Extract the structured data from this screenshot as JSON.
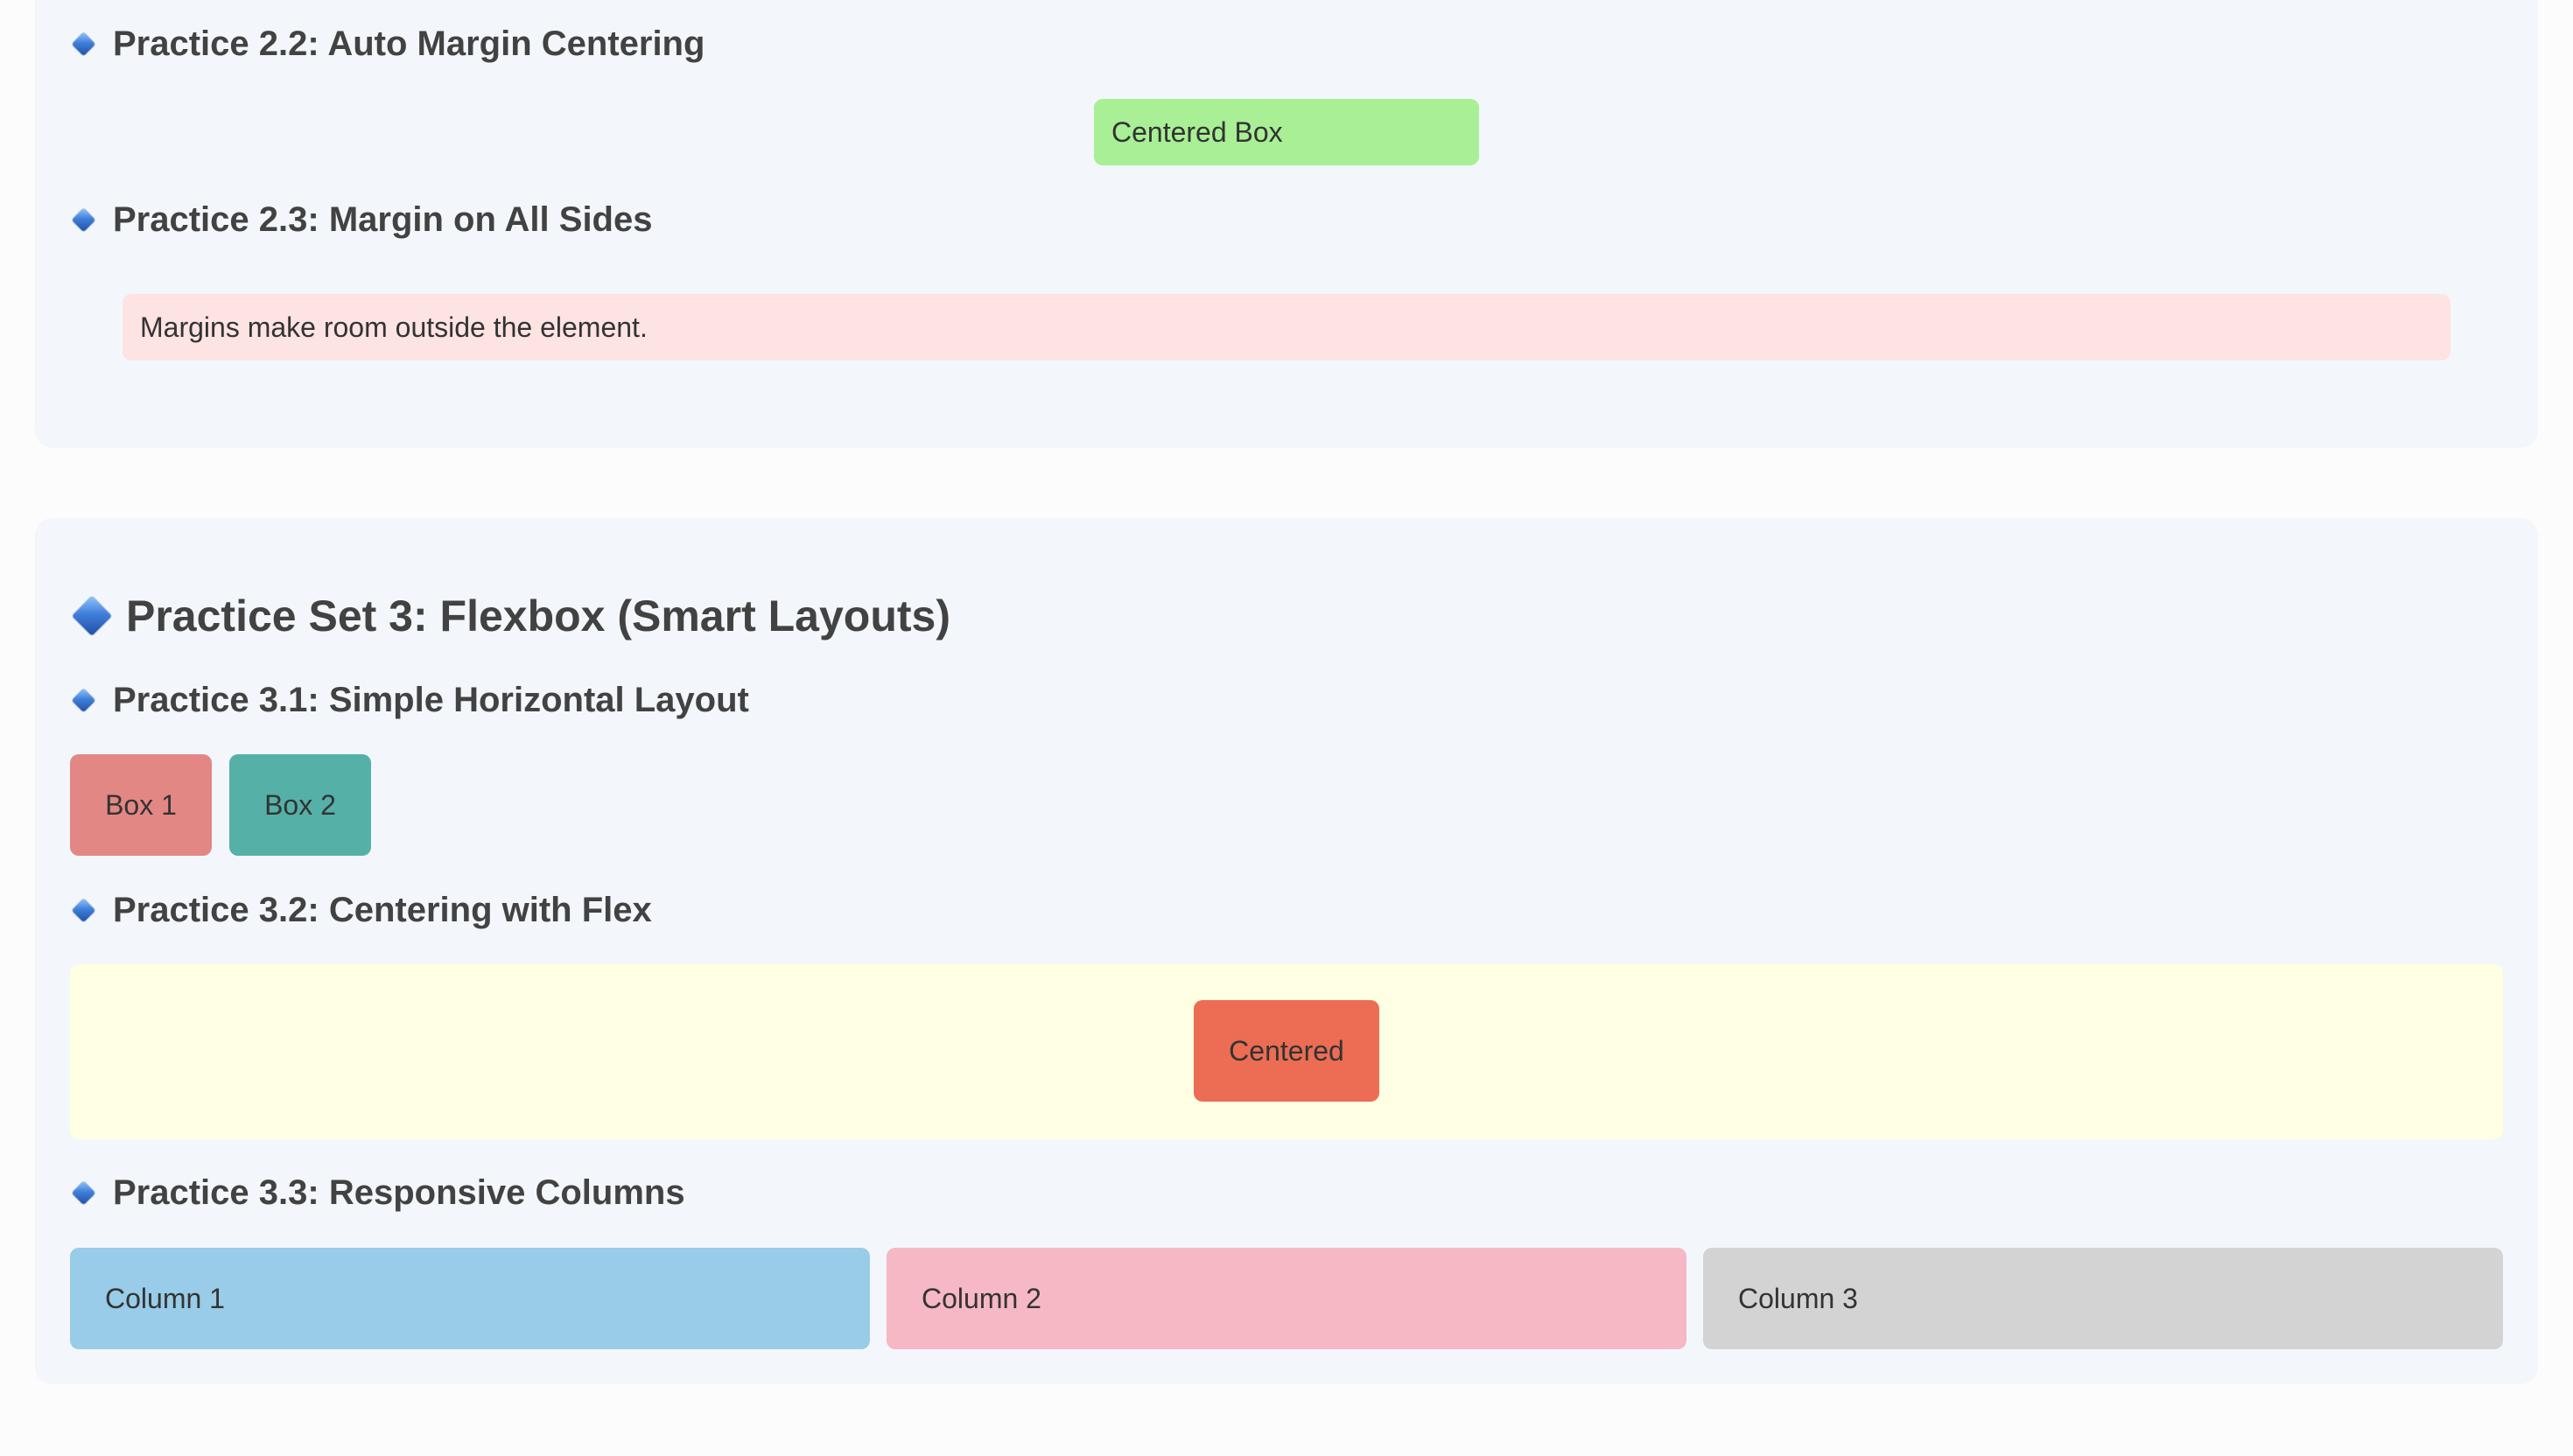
{
  "colors": {
    "page_background": "#fcfcfd",
    "card_background": "#f3f7fb",
    "heading_text": "#424242",
    "diamond_icon": "#3f7fd9",
    "centered_box": "#a8ef95",
    "margin_box": "#fde3e2",
    "box_1": "#e38785",
    "box_2": "#55b0a8",
    "flex_container": "#ffffe3",
    "centered_flex_box": "#ec6d53",
    "column_1": "#98cce8",
    "column_2": "#f5b8c4",
    "column_3": "#d3d3d3"
  },
  "set2": {
    "practice_2_2": {
      "icon": "blue-diamond-icon",
      "title": "Practice 2.2: Auto Margin Centering",
      "box_label": "Centered Box"
    },
    "practice_2_3": {
      "icon": "blue-diamond-icon",
      "title": "Practice 2.3: Margin on All Sides",
      "box_text": "Margins make room outside the element."
    }
  },
  "set3": {
    "icon": "blue-diamond-icon",
    "title": "Practice Set 3: Flexbox (Smart Layouts)",
    "practice_3_1": {
      "icon": "blue-diamond-icon",
      "title": "Practice 3.1: Simple Horizontal Layout",
      "boxes": [
        "Box 1",
        "Box 2"
      ]
    },
    "practice_3_2": {
      "icon": "blue-diamond-icon",
      "title": "Practice 3.2: Centering with Flex",
      "box_label": "Centered"
    },
    "practice_3_3": {
      "icon": "blue-diamond-icon",
      "title": "Practice 3.3: Responsive Columns",
      "columns": [
        "Column 1",
        "Column 2",
        "Column 3"
      ]
    }
  }
}
